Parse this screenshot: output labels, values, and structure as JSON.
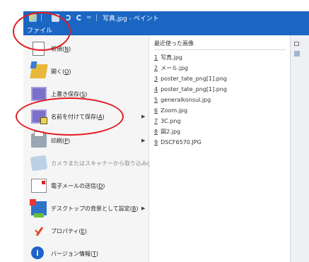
{
  "window": {
    "title": "写真.jpg - ペイント"
  },
  "titlebar_icons": {
    "app": "paint-app-icon",
    "save": "save-icon",
    "undo": "undo-icon",
    "redo": "redo-icon",
    "customize": "customize-quick-access-icon"
  },
  "ribbon": {
    "file_tab": "ファイル"
  },
  "menu": {
    "items": [
      {
        "label": "新規(",
        "key": "N",
        "suffix": ")",
        "icon": "new-document-icon",
        "enabled": true,
        "arrow": false
      },
      {
        "label": "開く(",
        "key": "O",
        "suffix": ")",
        "icon": "open-folder-icon",
        "enabled": true,
        "arrow": false
      },
      {
        "label": "上書き保存(",
        "key": "S",
        "suffix": ")",
        "icon": "save-icon",
        "enabled": true,
        "arrow": false
      },
      {
        "label": "名前を付けて保存(",
        "key": "A",
        "suffix": ")",
        "icon": "save-as-icon",
        "enabled": true,
        "arrow": true
      },
      {
        "label": "印刷(",
        "key": "P",
        "suffix": ")",
        "icon": "print-icon",
        "enabled": true,
        "arrow": true
      },
      {
        "label": "カメラまたはスキャナーから取り込み(",
        "key": "M",
        "suffix": ")",
        "icon": "scanner-icon",
        "enabled": false,
        "arrow": false
      },
      {
        "label": "電子メールの送信(",
        "key": "D",
        "suffix": ")",
        "icon": "email-icon",
        "enabled": true,
        "arrow": false
      },
      {
        "label": "デスクトップの背景として設定(",
        "key": "B",
        "suffix": ")",
        "icon": "desktop-background-icon",
        "enabled": true,
        "arrow": true
      },
      {
        "label": "プロパティ(",
        "key": "E",
        "suffix": ")",
        "icon": "properties-checkmark-icon",
        "enabled": true,
        "arrow": false
      },
      {
        "label": "バージョン情報(",
        "key": "T",
        "suffix": ")",
        "icon": "info-icon",
        "enabled": true,
        "arrow": false
      }
    ],
    "info_glyph": "i",
    "arrow_glyph": "▶"
  },
  "recent": {
    "title": "最近使った画像",
    "items": [
      {
        "num": "1",
        "name": "写真.jpg"
      },
      {
        "num": "2",
        "name": "メール.jpg"
      },
      {
        "num": "3",
        "name": "poster_tate_png[1].png"
      },
      {
        "num": "4",
        "name": "poster_tate_png[1].png"
      },
      {
        "num": "5",
        "name": "generalkonsul.jpg"
      },
      {
        "num": "6",
        "name": "Zoom.jpg"
      },
      {
        "num": "7",
        "name": "3C.png"
      },
      {
        "num": "8",
        "name": "図2.jpg"
      },
      {
        "num": "9",
        "name": "DSCF6570.JPG"
      }
    ]
  },
  "colors": {
    "titlebar": "#1a66c2",
    "menu_bg": "#f5f5f5",
    "annotation": "#e21b22"
  }
}
